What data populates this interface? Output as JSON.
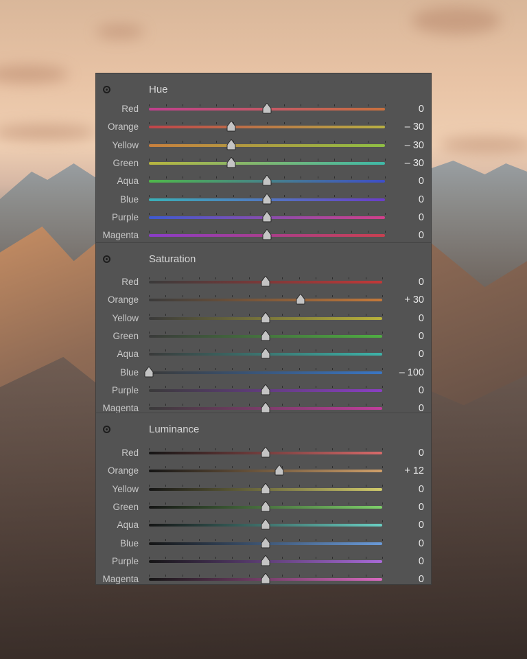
{
  "hsl_panel": {
    "sections": [
      {
        "id": "hue",
        "title": "Hue",
        "track_width": 344,
        "rows": [
          {
            "label": "Red",
            "value": "0",
            "level": 0,
            "gradient": [
              "#c0408e",
              "#c9713e"
            ]
          },
          {
            "label": "Orange",
            "value": "– 30",
            "level": -30,
            "gradient": [
              "#c0444a",
              "#b8b043"
            ]
          },
          {
            "label": "Yellow",
            "value": "– 30",
            "level": -30,
            "gradient": [
              "#c9803e",
              "#8fbf44"
            ]
          },
          {
            "label": "Green",
            "value": "– 30",
            "level": -30,
            "gradient": [
              "#b8b53f",
              "#3fb8a8"
            ]
          },
          {
            "label": "Aqua",
            "value": "0",
            "level": 0,
            "gradient": [
              "#4fb84a",
              "#3e4ec8"
            ]
          },
          {
            "label": "Blue",
            "value": "0",
            "level": 0,
            "gradient": [
              "#3ab0b8",
              "#6a3ec8"
            ]
          },
          {
            "label": "Purple",
            "value": "0",
            "level": 0,
            "gradient": [
              "#3e5ad0",
              "#d0408a"
            ]
          },
          {
            "label": "Magenta",
            "value": "0",
            "level": 0,
            "gradient": [
              "#8a3ec8",
              "#c84050"
            ]
          }
        ]
      },
      {
        "id": "saturation",
        "title": "Saturation",
        "track_width": 340,
        "rows": [
          {
            "label": "Red",
            "value": "0",
            "level": 0,
            "gradient": [
              "#3a3a3a",
              "#c23838"
            ]
          },
          {
            "label": "Orange",
            "value": "+ 30",
            "level": 30,
            "gradient": [
              "#3a3a3a",
              "#c5793a"
            ]
          },
          {
            "label": "Yellow",
            "value": "0",
            "level": 0,
            "gradient": [
              "#3a3a3a",
              "#b9b23c"
            ]
          },
          {
            "label": "Green",
            "value": "0",
            "level": 0,
            "gradient": [
              "#3a3a3a",
              "#4fae42"
            ]
          },
          {
            "label": "Aqua",
            "value": "0",
            "level": 0,
            "gradient": [
              "#3a3a3a",
              "#3db3a9"
            ]
          },
          {
            "label": "Blue",
            "value": "– 100",
            "level": -100,
            "gradient": [
              "#3a3a3a",
              "#3a76c4"
            ]
          },
          {
            "label": "Purple",
            "value": "0",
            "level": 0,
            "gradient": [
              "#3a3a3a",
              "#8a3fc4"
            ]
          },
          {
            "label": "Magenta",
            "value": "0",
            "level": 0,
            "gradient": [
              "#3a3a3a",
              "#c03e9c"
            ]
          }
        ]
      },
      {
        "id": "luminance",
        "title": "Luminance",
        "track_width": 340,
        "rows": [
          {
            "label": "Red",
            "value": "0",
            "level": 0,
            "gradient": [
              "#151515",
              "#d86a6a"
            ]
          },
          {
            "label": "Orange",
            "value": "+ 12",
            "level": 12,
            "gradient": [
              "#151515",
              "#d0a06a"
            ]
          },
          {
            "label": "Yellow",
            "value": "0",
            "level": 0,
            "gradient": [
              "#151515",
              "#d2cc6c"
            ]
          },
          {
            "label": "Green",
            "value": "0",
            "level": 0,
            "gradient": [
              "#151515",
              "#7ed06a"
            ]
          },
          {
            "label": "Aqua",
            "value": "0",
            "level": 0,
            "gradient": [
              "#151515",
              "#6ad0c4"
            ]
          },
          {
            "label": "Blue",
            "value": "0",
            "level": 0,
            "gradient": [
              "#151515",
              "#6a9ad8"
            ]
          },
          {
            "label": "Purple",
            "value": "0",
            "level": 0,
            "gradient": [
              "#151515",
              "#a86ad8"
            ]
          },
          {
            "label": "Magenta",
            "value": "0",
            "level": 0,
            "gradient": [
              "#151515",
              "#d86ac0"
            ]
          }
        ]
      }
    ],
    "icons": {
      "target": "target-adjustment-icon",
      "thumb": "slider-thumb"
    }
  }
}
